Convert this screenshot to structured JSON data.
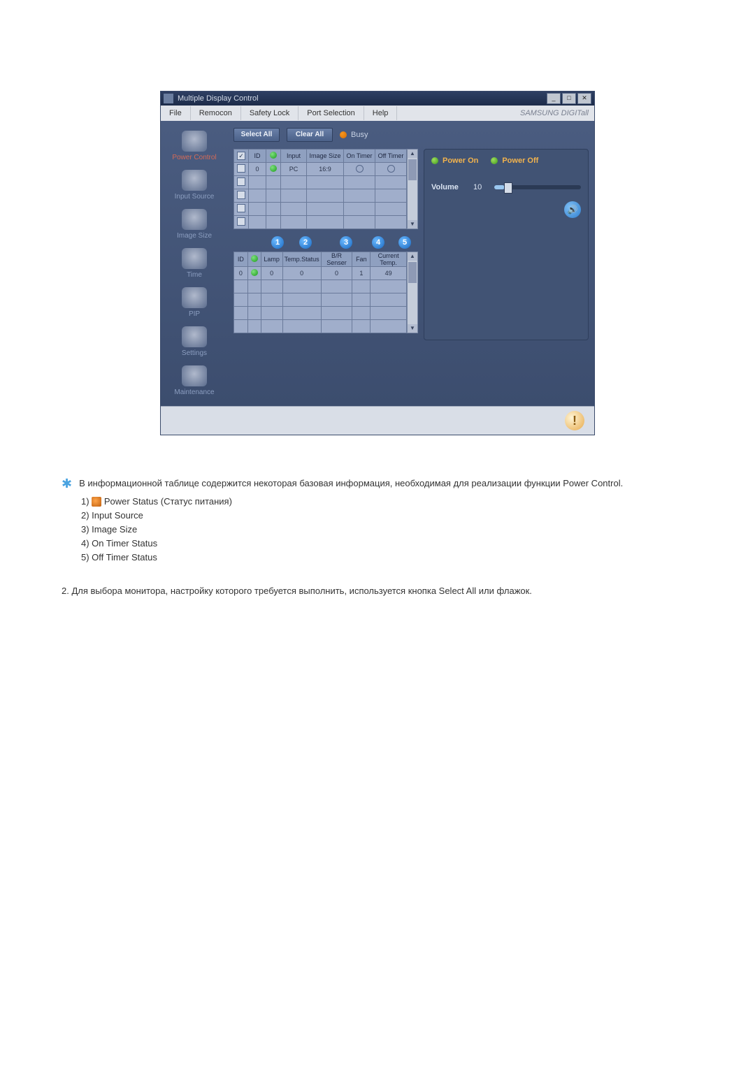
{
  "window": {
    "title": "Multiple Display Control",
    "brand": "SAMSUNG DIGITall"
  },
  "menu": [
    "File",
    "Remocon",
    "Safety Lock",
    "Port Selection",
    "Help"
  ],
  "sidebar": [
    {
      "label": "Power Control",
      "active": true
    },
    {
      "label": "Input Source"
    },
    {
      "label": "Image Size"
    },
    {
      "label": "Time"
    },
    {
      "label": "PIP"
    },
    {
      "label": "Settings"
    },
    {
      "label": "Maintenance"
    }
  ],
  "toolbar": {
    "select_all": "Select All",
    "clear_all": "Clear All",
    "busy": "Busy"
  },
  "table1": {
    "headers": [
      "",
      "ID",
      "",
      "Input",
      "Image Size",
      "On Timer",
      "Off Timer"
    ],
    "row": {
      "checked": false,
      "id": "0",
      "input": "PC",
      "image_size": "16:9"
    }
  },
  "callouts": [
    "1",
    "2",
    "3",
    "4",
    "5"
  ],
  "table2": {
    "headers": [
      "ID",
      "",
      "Lamp",
      "Temp.Status",
      "B/R Senser",
      "Fan",
      "Current Temp."
    ],
    "row": {
      "id": "0",
      "lamp": "0",
      "temp_status": "0",
      "br": "0",
      "fan": "1",
      "cur_temp": "49"
    }
  },
  "ctrl": {
    "power_on": "Power On",
    "power_off": "Power Off",
    "volume_label": "Volume",
    "volume_value": "10"
  },
  "below": {
    "note": "В информационной таблице содержится некоторая базовая информация, необходимая для реализации функции Power Control.",
    "l1": "1)",
    "l1_text": "Power Status (Статус питания)",
    "l2": "2) Input Source",
    "l3": "3) Image Size",
    "l4": "4) On Timer Status",
    "l5": "5) Off Timer Status",
    "para2": "2.  Для выбора монитора, настройку которого требуется выполнить, используется кнопка Select All или флажок."
  }
}
